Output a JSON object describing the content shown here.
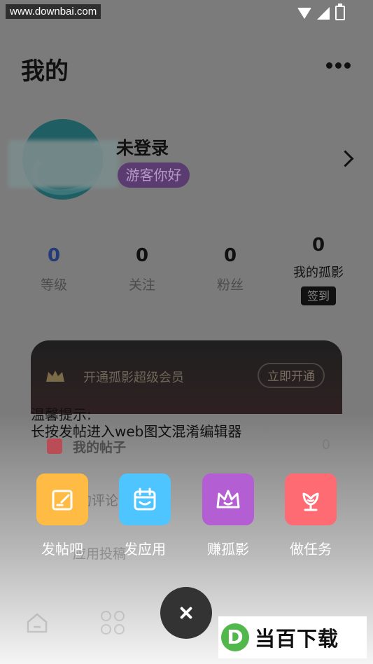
{
  "status_bar": {
    "watermark": "www.downbai.com"
  },
  "header": {
    "title": "我的"
  },
  "profile": {
    "name": "未登录",
    "badge": "游客你好"
  },
  "stats": [
    {
      "value": "0",
      "label": "等级"
    },
    {
      "value": "0",
      "label": "关注"
    },
    {
      "value": "0",
      "label": "粉丝"
    },
    {
      "value": "0",
      "label": "我的孤影",
      "action": "签到"
    }
  ],
  "vip": {
    "text": "开通孤影超级会员",
    "button": "立即开通"
  },
  "tip": {
    "title": "温馨提示:",
    "body": "长按发帖进入web图文混淆编辑器"
  },
  "menu": {
    "posts_label": "我的帖子",
    "posts_count": "0",
    "comments_label": "的评论",
    "submit_label": "应用投稿"
  },
  "actions": [
    {
      "label": "发帖吧",
      "color": "#ffbb44",
      "icon": "edit-icon"
    },
    {
      "label": "发应用",
      "color": "#4fc5ff",
      "icon": "calendar-icon"
    },
    {
      "label": "赚孤影",
      "color": "#b45ed4",
      "icon": "crown-icon"
    },
    {
      "label": "做任务",
      "color": "#ff6b73",
      "icon": "flower-icon"
    }
  ],
  "logo": {
    "mark": "D",
    "text": "当百下载"
  }
}
